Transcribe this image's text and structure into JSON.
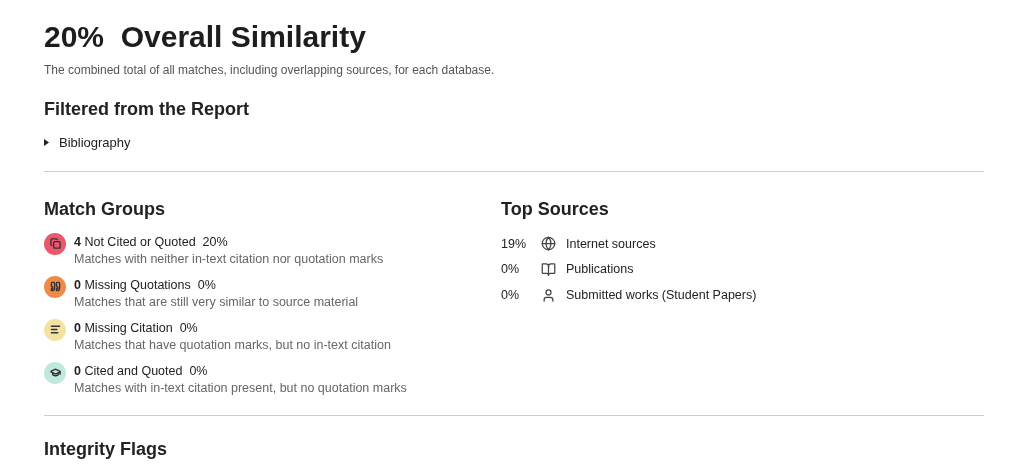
{
  "header": {
    "percent": "20%",
    "title": "Overall Similarity",
    "description": "The combined total of all matches, including overlapping sources, for each database."
  },
  "filtered": {
    "heading": "Filtered from the Report",
    "items": [
      {
        "label": "Bibliography",
        "expanded": false
      }
    ]
  },
  "match_groups": {
    "heading": "Match Groups",
    "items": [
      {
        "kind": "not-cited",
        "color": "#e9596b",
        "count": "4",
        "label": "Not Cited or Quoted",
        "percent": "20%",
        "description": "Matches with neither in-text citation nor quotation marks"
      },
      {
        "kind": "missing-quotations",
        "color": "#f08a4b",
        "count": "0",
        "label": "Missing Quotations",
        "percent": "0%",
        "description": "Matches that are still very similar to source material"
      },
      {
        "kind": "missing-citation",
        "color": "#f3e3a3",
        "count": "0",
        "label": "Missing Citation",
        "percent": "0%",
        "description": "Matches that have quotation marks, but no in-text citation"
      },
      {
        "kind": "cited-quoted",
        "color": "#bfe9dc",
        "count": "0",
        "label": "Cited and Quoted",
        "percent": "0%",
        "description": "Matches with in-text citation present, but no quotation marks"
      }
    ]
  },
  "top_sources": {
    "heading": "Top Sources",
    "items": [
      {
        "kind": "internet",
        "percent": "19%",
        "label": "Internet sources"
      },
      {
        "kind": "publications",
        "percent": "0%",
        "label": "Publications"
      },
      {
        "kind": "submitted",
        "percent": "0%",
        "label": "Submitted works (Student Papers)"
      }
    ]
  },
  "integrity": {
    "heading": "Integrity Flags"
  }
}
